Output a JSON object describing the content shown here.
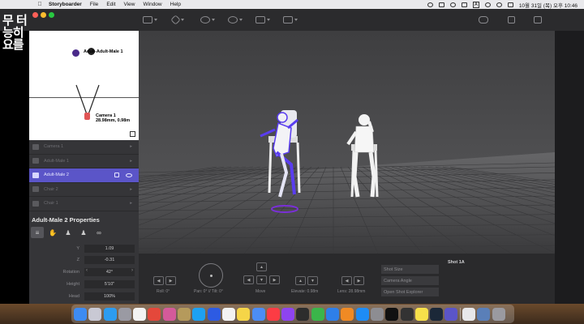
{
  "menubar": {
    "app_name": "Storyboarder",
    "items": [
      "File",
      "Edit",
      "View",
      "Window",
      "Help"
    ],
    "datetime": "10월 31일 (목) 오후 10:46",
    "input_indicator": "A"
  },
  "watermark": {
    "line1": "무 터",
    "line2": "능히요를"
  },
  "minimap": {
    "char_label": "Adult-Adult-Male 1",
    "char_label2": "Adult-Male 2",
    "camera_name": "Camera 1",
    "camera_info": "28.98mm, 0.98m"
  },
  "object_list": [
    {
      "label": "Camera 1",
      "selected": false
    },
    {
      "label": "Adult-Male 1",
      "selected": false
    },
    {
      "label": "Adult-Male 2",
      "selected": true
    },
    {
      "label": "Chair 2",
      "selected": false
    },
    {
      "label": "Chair 1",
      "selected": false
    }
  ],
  "properties": {
    "title": "Adult-Male 2 Properties",
    "rows": [
      {
        "key": "Y",
        "value": "1.09"
      },
      {
        "key": "Z",
        "value": "-0.31"
      },
      {
        "key": "Rotation",
        "value": "42°"
      },
      {
        "key": "Height",
        "value": "5'10\""
      },
      {
        "key": "Head",
        "value": "100%"
      }
    ]
  },
  "controls": {
    "roll_label": "Roll: 0°",
    "pan_tilt_label": "Pan: 0° // Tilt: 0°",
    "move_label": "Move",
    "elevate_label": "Elevate: 0.98m",
    "lens_label": "Lens: 28.98mm",
    "shot_size": "Shot Size",
    "camera_angle": "Camera Angle",
    "open_explorer": "Open Shot Explorer",
    "shot_name": "Shot 1A"
  },
  "colors": {
    "accent": "#5b55c8",
    "selected_figure": "#5a3df0",
    "panel": "#353538",
    "toolbar": "#2b2b2d"
  }
}
